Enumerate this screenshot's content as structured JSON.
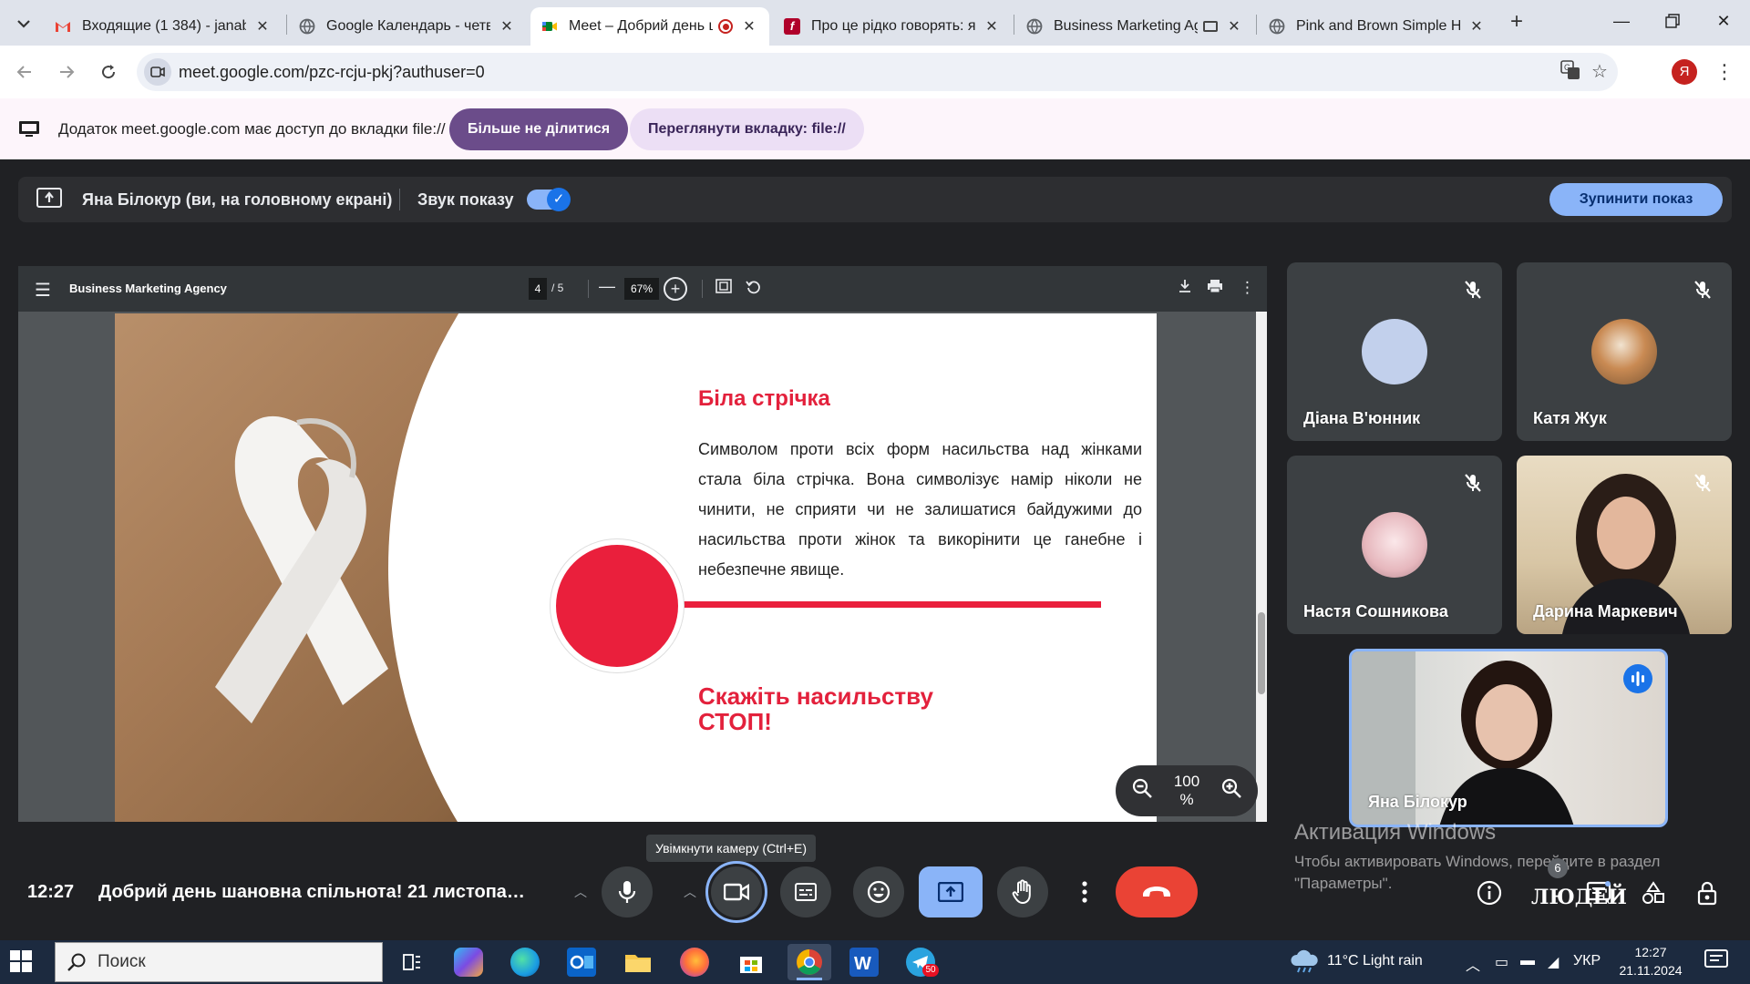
{
  "browser": {
    "tabs": [
      {
        "title": "Входящие (1 384) - janabil",
        "icon": "gmail-icon",
        "color": "#ea4335"
      },
      {
        "title": "Google Календарь - четве",
        "icon": "globe-icon",
        "color": "#5f6368"
      },
      {
        "title": "Meet – Добрий день ш",
        "icon": "meet-icon",
        "color": "#00832d",
        "recording": true
      },
      {
        "title": "Про це рідко говорять: як",
        "icon": "flipbook-icon",
        "color": "#b0002a"
      },
      {
        "title": "Business Marketing Ag",
        "icon": "globe-icon",
        "color": "#5f6368"
      },
      {
        "title": "Pink and Brown Simple Ha",
        "icon": "globe-icon",
        "color": "#5f6368"
      }
    ],
    "url": "meet.google.com/pzc-rcju-pkj?authuser=0",
    "profile_initial": "Я"
  },
  "share_notice": {
    "message": "Додаток meet.google.com має доступ до вкладки file://",
    "stop_sharing": "Більше не ділитися",
    "view_tab": "Переглянути вкладку: file://"
  },
  "presenting": {
    "presenter": "Яна Білокур (ви, на головному екрані)",
    "audio_label": "Звук показу",
    "audio_on": true,
    "stop_button": "Зупинити показ"
  },
  "pdf": {
    "document": "Business Marketing Agency",
    "page": "4",
    "total": "/ 5",
    "zoom": "67%",
    "overlay_zoom": "100 %"
  },
  "slide": {
    "title": "Біла стрічка",
    "body": "Символом проти всіх форм насильства над жінками стала біла стрічка. Вона символізує намір ніколи не чинити, не сприяти чи не залишатися байдужими до насильства проти жінок та викорінити це ганебне і небезпечне явище.",
    "cta_line1": "Скажіть насильству",
    "cta_line2": "СТОП!",
    "accent": "#e3213c"
  },
  "participants": [
    {
      "name": "Діана В'юнник",
      "muted": true
    },
    {
      "name": "Катя Жук",
      "muted": true
    },
    {
      "name": "Настя Сошникова",
      "muted": true
    },
    {
      "name": "Дарина Маркевич",
      "muted": true
    },
    {
      "name": "Яна Білокур",
      "speaking": true
    }
  ],
  "tooltip": "Увімкнути камеру (Ctrl+E)",
  "watermark": {
    "title": "Активация Windows",
    "body": "Чтобы активировать Windows, перейдите в раздел \"Параметры\"."
  },
  "meeting": {
    "time": "12:27",
    "title": "Добрий день шановна спільнота! 21 листопада ...",
    "people_count": "6",
    "people_label": "ЛЮДЕЙ"
  },
  "taskbar": {
    "search_placeholder": "Поиск",
    "weather": "11°C  Light rain",
    "language": "УКР",
    "time": "12:27",
    "date": "21.11.2024",
    "telegram_badge": "50"
  }
}
